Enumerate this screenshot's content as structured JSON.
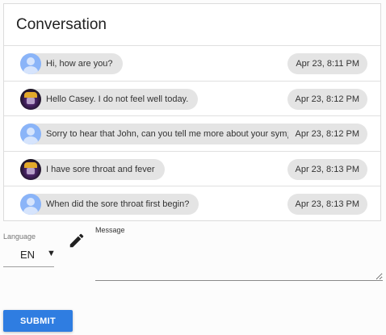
{
  "conversation": {
    "title": "Conversation",
    "messages": [
      {
        "avatar": "default-user-icon",
        "text": "Hi, how are you?",
        "time": "Apr 23, 8:11 PM"
      },
      {
        "avatar": "user-photo",
        "text": "Hello Casey. I do not feel well today.",
        "time": "Apr 23, 8:12 PM"
      },
      {
        "avatar": "default-user-icon",
        "text": "Sorry to hear that John, can you tell me more about your symptoms?",
        "time": "Apr 23, 8:12 PM"
      },
      {
        "avatar": "user-photo",
        "text": "I have sore throat and fever",
        "time": "Apr 23, 8:13 PM"
      },
      {
        "avatar": "default-user-icon",
        "text": "When did the sore throat first begin?",
        "time": "Apr 23, 8:13 PM"
      }
    ]
  },
  "form": {
    "language_label": "Language",
    "language_value": "EN",
    "language_arrow": "▼",
    "edit_icon": "pencil-icon",
    "message_label": "Message",
    "message_value": "",
    "submit_label": "SUBMIT"
  },
  "colors": {
    "accent": "#2f7de1",
    "chip": "#e4e4e4",
    "avatar_default": "#8ab4f8"
  }
}
